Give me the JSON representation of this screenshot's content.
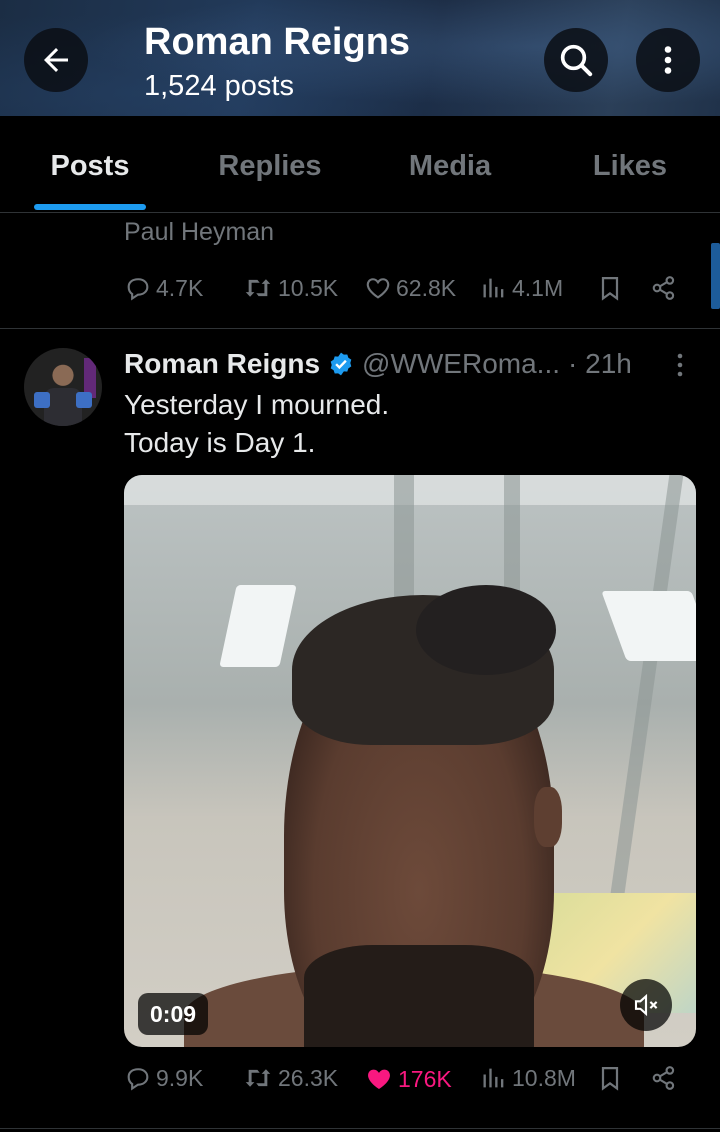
{
  "header": {
    "title": "Roman Reigns",
    "subtitle": "1,524 posts",
    "icons": [
      "back-arrow-icon",
      "search-icon",
      "more-vertical-icon"
    ]
  },
  "tabs": [
    {
      "label": "Posts",
      "active": true
    },
    {
      "label": "Replies",
      "active": false
    },
    {
      "label": "Media",
      "active": false
    },
    {
      "label": "Likes",
      "active": false
    }
  ],
  "previous_tweet": {
    "author_fragment": "Paul Heyman",
    "replies": "4.7K",
    "reposts": "10.5K",
    "likes": "62.8K",
    "views": "4.1M"
  },
  "tweet": {
    "name": "Roman Reigns",
    "handle": "@WWERoma...",
    "time": "· 21h",
    "verified": true,
    "text_line1": "Yesterday I mourned.",
    "text_line2": "Today is Day 1.",
    "video_duration": "0:09",
    "video_muted": true,
    "replies": "9.9K",
    "reposts": "26.3K",
    "likes": "176K",
    "liked": true,
    "views": "10.8M"
  },
  "colors": {
    "accent": "#1d9bf0",
    "like": "#f91880",
    "muted_text": "#71767b",
    "background": "#000000"
  }
}
